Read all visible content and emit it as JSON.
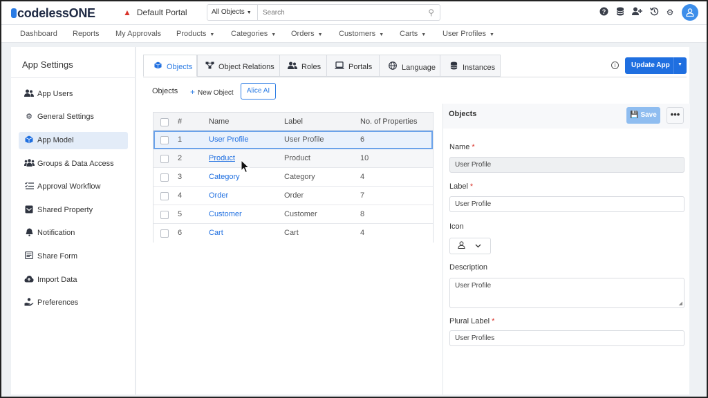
{
  "app": {
    "logo_prefix": "codeless",
    "logo_suffix": "ONE",
    "portal_name": "Default Portal"
  },
  "search": {
    "scope": "All Objects",
    "placeholder": "Search"
  },
  "nav": {
    "items": [
      {
        "label": "Dashboard",
        "dropdown": false
      },
      {
        "label": "Reports",
        "dropdown": false
      },
      {
        "label": "My Approvals",
        "dropdown": false
      },
      {
        "label": "Products",
        "dropdown": true
      },
      {
        "label": "Categories",
        "dropdown": true
      },
      {
        "label": "Orders",
        "dropdown": true
      },
      {
        "label": "Customers",
        "dropdown": true
      },
      {
        "label": "Carts",
        "dropdown": true
      },
      {
        "label": "User Profiles",
        "dropdown": true
      }
    ]
  },
  "sidebar": {
    "title": "App Settings",
    "items": [
      {
        "label": "App Users",
        "icon": "users-icon"
      },
      {
        "label": "General Settings",
        "icon": "gear-icon"
      },
      {
        "label": "App Model",
        "icon": "cube-icon",
        "active": true
      },
      {
        "label": "Groups & Data Access",
        "icon": "group-icon"
      },
      {
        "label": "Approval Workflow",
        "icon": "checklist-icon"
      },
      {
        "label": "Shared Property",
        "icon": "inbox-icon"
      },
      {
        "label": "Notification",
        "icon": "bell-icon"
      },
      {
        "label": "Share Form",
        "icon": "form-icon"
      },
      {
        "label": "Import Data",
        "icon": "cloud-upload-icon"
      },
      {
        "label": "Preferences",
        "icon": "hand-icon"
      }
    ]
  },
  "tabs": [
    {
      "label": "Objects",
      "icon": "cube-icon",
      "active": true
    },
    {
      "label": "Object Relations",
      "icon": "relations-icon"
    },
    {
      "label": "Roles",
      "icon": "users-icon"
    },
    {
      "label": "Portals",
      "icon": "laptop-icon"
    },
    {
      "label": "Language",
      "icon": "globe-icon"
    },
    {
      "label": "Instances",
      "icon": "database-icon"
    }
  ],
  "toolbar": {
    "update_label": "Update App",
    "objects_label": "Objects",
    "new_object_label": "New Object",
    "alice_label": "Alice AI"
  },
  "table": {
    "headers": [
      "#",
      "Name",
      "Label",
      "No. of Properties"
    ],
    "rows": [
      {
        "num": "1",
        "name": "User Profile",
        "label": "User Profile",
        "props": "6",
        "selected": true
      },
      {
        "num": "2",
        "name": "Product",
        "label": "Product",
        "props": "10",
        "hover": true
      },
      {
        "num": "3",
        "name": "Category",
        "label": "Category",
        "props": "4"
      },
      {
        "num": "4",
        "name": "Order",
        "label": "Order",
        "props": "7"
      },
      {
        "num": "5",
        "name": "Customer",
        "label": "Customer",
        "props": "8"
      },
      {
        "num": "6",
        "name": "Cart",
        "label": "Cart",
        "props": "4"
      }
    ]
  },
  "panel": {
    "title": "Objects",
    "save_label": "Save",
    "more_label": "•••",
    "name_label": "Name",
    "name_value": "User Profile",
    "label_label": "Label",
    "label_value": "User Profile",
    "icon_label": "Icon",
    "description_label": "Description",
    "description_value": "User Profile",
    "plural_label": "Plural Label",
    "plural_value": "User Profiles"
  },
  "colors": {
    "accent": "#1f6fe0",
    "link": "#1f6fe0",
    "required": "#d9342b",
    "active_bg": "#e3ecf8"
  }
}
